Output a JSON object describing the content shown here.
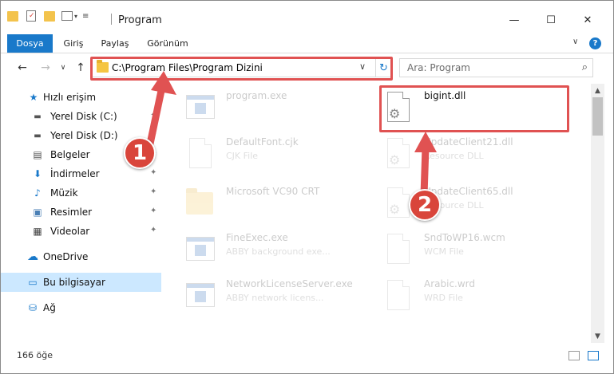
{
  "window": {
    "title": "Program",
    "controls": {
      "minimize": "—",
      "maximize": "☐",
      "close": "✕"
    }
  },
  "ribbon": {
    "tabs": [
      {
        "label": "Dosya",
        "active": true
      },
      {
        "label": "Giriş"
      },
      {
        "label": "Paylaş"
      },
      {
        "label": "Görünüm"
      }
    ],
    "expand_glyph": "∨",
    "help_glyph": "?"
  },
  "nav": {
    "back": "←",
    "forward": "→",
    "recent": "∨",
    "up": "↑",
    "address": "C:\\Program Files\\Program Dizini",
    "address_dropdown": "∨",
    "refresh": "↻",
    "search_placeholder": "Ara: Program",
    "search_glyph": "⌕"
  },
  "sidebar": {
    "items": [
      {
        "label": "Hızlı erişim",
        "icon": "star-icon",
        "glyph": "★"
      },
      {
        "label": "Yerel Disk (C:)",
        "icon": "drive-icon",
        "glyph": "▬",
        "pinned": true
      },
      {
        "label": "Yerel Disk (D:)",
        "icon": "drive-icon",
        "glyph": "▬",
        "pinned": true
      },
      {
        "label": "Belgeler",
        "icon": "documents-icon",
        "glyph": "▤",
        "pinned": true
      },
      {
        "label": "İndirmeler",
        "icon": "download-icon",
        "glyph": "⬇",
        "pinned": true
      },
      {
        "label": "Müzik",
        "icon": "music-icon",
        "glyph": "♪",
        "pinned": true
      },
      {
        "label": "Resimler",
        "icon": "pictures-icon",
        "glyph": "▣",
        "pinned": true
      },
      {
        "label": "Videolar",
        "icon": "video-icon",
        "glyph": "▦",
        "pinned": true
      },
      {
        "label": "OneDrive",
        "icon": "cloud-icon",
        "glyph": "☁"
      },
      {
        "label": "Bu bilgisayar",
        "icon": "computer-icon",
        "glyph": "▭",
        "selected": true
      },
      {
        "label": "Ağ",
        "icon": "network-icon",
        "glyph": "⛁"
      }
    ],
    "pin_glyph": "📌"
  },
  "files": [
    {
      "name": "program.exe",
      "type": "",
      "icon": "exe-icon"
    },
    {
      "name": "bigint.dll",
      "type": "",
      "icon": "dll-icon",
      "highlighted": true
    },
    {
      "name": "DefaultFont.cjk",
      "type": "CJK File",
      "icon": "file-icon"
    },
    {
      "name": "UpdateClient21.dll",
      "type": "Resource DLL",
      "icon": "dll-icon"
    },
    {
      "name": "Microsoft VC90 CRT",
      "type": "",
      "icon": "folder-icon"
    },
    {
      "name": "UpdateClient65.dll",
      "type": "Resource DLL",
      "icon": "dll-icon"
    },
    {
      "name": "FineExec.exe",
      "type": "ABBY background exe...",
      "icon": "exe-icon"
    },
    {
      "name": "SndToWP16.wcm",
      "type": "WCM File",
      "icon": "file-icon"
    },
    {
      "name": "NetworkLicenseServer.exe",
      "type": "ABBY network licens...",
      "icon": "exe-icon"
    },
    {
      "name": "Arabic.wrd",
      "type": "WRD File",
      "icon": "file-icon"
    }
  ],
  "annotations": [
    {
      "number": "1"
    },
    {
      "number": "2"
    }
  ],
  "status": {
    "item_count": "166 öğe"
  },
  "colors": {
    "accent": "#1979ca",
    "highlight": "#e05252",
    "badge": "#d9453b"
  }
}
